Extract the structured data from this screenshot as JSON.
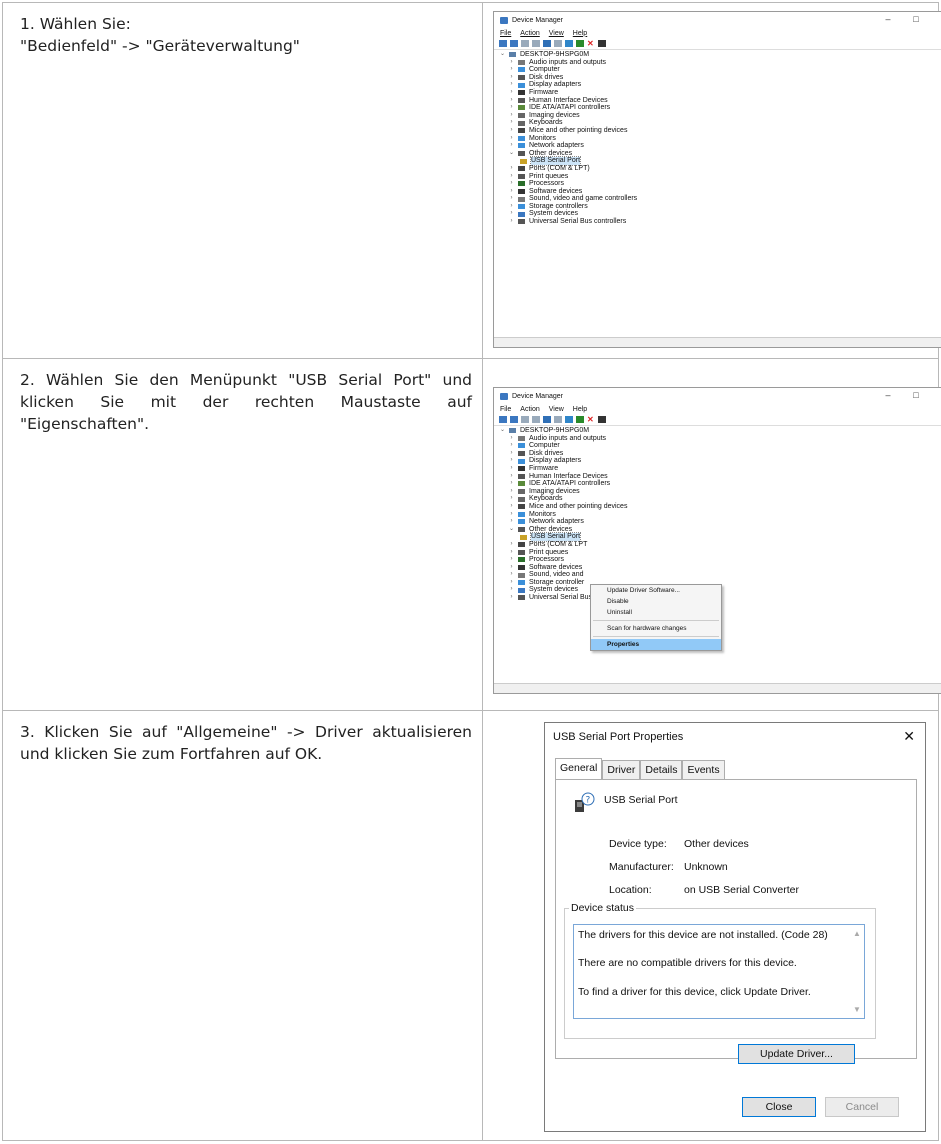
{
  "steps": [
    {
      "line1": "1. Wählen Sie:",
      "line2": "\"Bedienfeld\" -> \"Geräteverwaltung\""
    },
    {
      "text": "2. Wählen Sie den Menüpunkt \"USB Serial Port\" und klicken Sie mit der rechten Maustaste auf \"Eigenschaften\"."
    },
    {
      "text": "3. Klicken Sie auf \"Allgemeine\" -> Driver aktualisieren und klicken Sie zum Fortfahren auf OK."
    }
  ],
  "device_manager": {
    "title": "Device Manager",
    "menu": [
      "File",
      "Action",
      "View",
      "Help"
    ],
    "root": "DESKTOP-9HSPG0M",
    "items": [
      "Audio inputs and outputs",
      "Computer",
      "Disk drives",
      "Display adapters",
      "Firmware",
      "Human Interface Devices",
      "IDE ATA/ATAPI controllers",
      "Imaging devices",
      "Keyboards",
      "Mice and other pointing devices",
      "Monitors",
      "Network adapters",
      "Other devices",
      "USB Serial Port",
      "Ports (COM & LPT)",
      "Print queues",
      "Processors",
      "Software devices",
      "Sound, video and game controllers",
      "Storage controllers",
      "System devices",
      "Universal Serial Bus controllers"
    ],
    "items_truncated": {
      "ports": "Ports (COM & LPT",
      "sound": "Sound, video and",
      "storage": "Storage controller"
    },
    "context_menu": [
      "Update Driver Software...",
      "Disable",
      "Uninstall",
      "Scan for hardware changes",
      "Properties"
    ]
  },
  "properties": {
    "title": "USB Serial Port Properties",
    "tabs": [
      "General",
      "Driver",
      "Details",
      "Events"
    ],
    "device_name": "USB Serial Port",
    "device_type_label": "Device type:",
    "device_type": "Other devices",
    "manufacturer_label": "Manufacturer:",
    "manufacturer": "Unknown",
    "location_label": "Location:",
    "location": "on USB Serial Converter",
    "status_legend": "Device status",
    "status_lines": [
      "The drivers for this device are not installed. (Code 28)",
      "There are no compatible drivers for this device.",
      "To find a driver for this device, click Update Driver."
    ],
    "update_button": "Update Driver...",
    "close_button": "Close",
    "cancel_button": "Cancel"
  }
}
